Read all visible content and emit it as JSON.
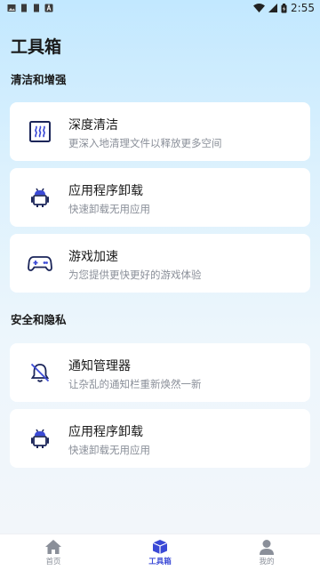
{
  "status_bar": {
    "time": "2:55",
    "left_icons": [
      "image-icon",
      "sd-card-icon",
      "sd-card-icon",
      "app-a-icon"
    ],
    "right_icons": [
      "wifi-icon",
      "signal-icon",
      "battery-icon"
    ]
  },
  "header": {
    "title": "工具箱"
  },
  "sections": [
    {
      "title": "清洁和增强",
      "items": [
        {
          "icon": "heater-icon",
          "title": "深度清洁",
          "desc": "更深入地清理文件以释放更多空间"
        },
        {
          "icon": "android-icon",
          "title": "应用程序卸载",
          "desc": "快速卸载无用应用"
        },
        {
          "icon": "gamepad-icon",
          "title": "游戏加速",
          "desc": "为您提供更快更好的游戏体验"
        }
      ]
    },
    {
      "title": "安全和隐私",
      "items": [
        {
          "icon": "bell-off-icon",
          "title": "通知管理器",
          "desc": "让杂乱的通知栏重新焕然一新"
        },
        {
          "icon": "android-icon",
          "title": "应用程序卸载",
          "desc": "快速卸载无用应用"
        }
      ]
    }
  ],
  "bottom_nav": {
    "items": [
      {
        "icon": "home-icon",
        "label": "首页",
        "active": false
      },
      {
        "icon": "toolbox-icon",
        "label": "工具箱",
        "active": true
      },
      {
        "icon": "user-icon",
        "label": "我的",
        "active": false
      }
    ]
  },
  "colors": {
    "accent": "#3a49d6",
    "icon_dark": "#1b2559",
    "inactive": "#8a8f99"
  }
}
